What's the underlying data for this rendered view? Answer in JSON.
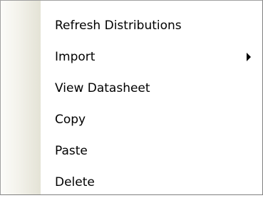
{
  "menu": {
    "items": [
      {
        "label": "Refresh Distributions",
        "has_submenu": false
      },
      {
        "label": "Import",
        "has_submenu": true
      },
      {
        "label": "View Datasheet",
        "has_submenu": false
      },
      {
        "label": "Copy",
        "has_submenu": false
      },
      {
        "label": "Paste",
        "has_submenu": false
      },
      {
        "label": "Delete",
        "has_submenu": false
      }
    ],
    "submenu_icon": "chevron-right-icon"
  }
}
